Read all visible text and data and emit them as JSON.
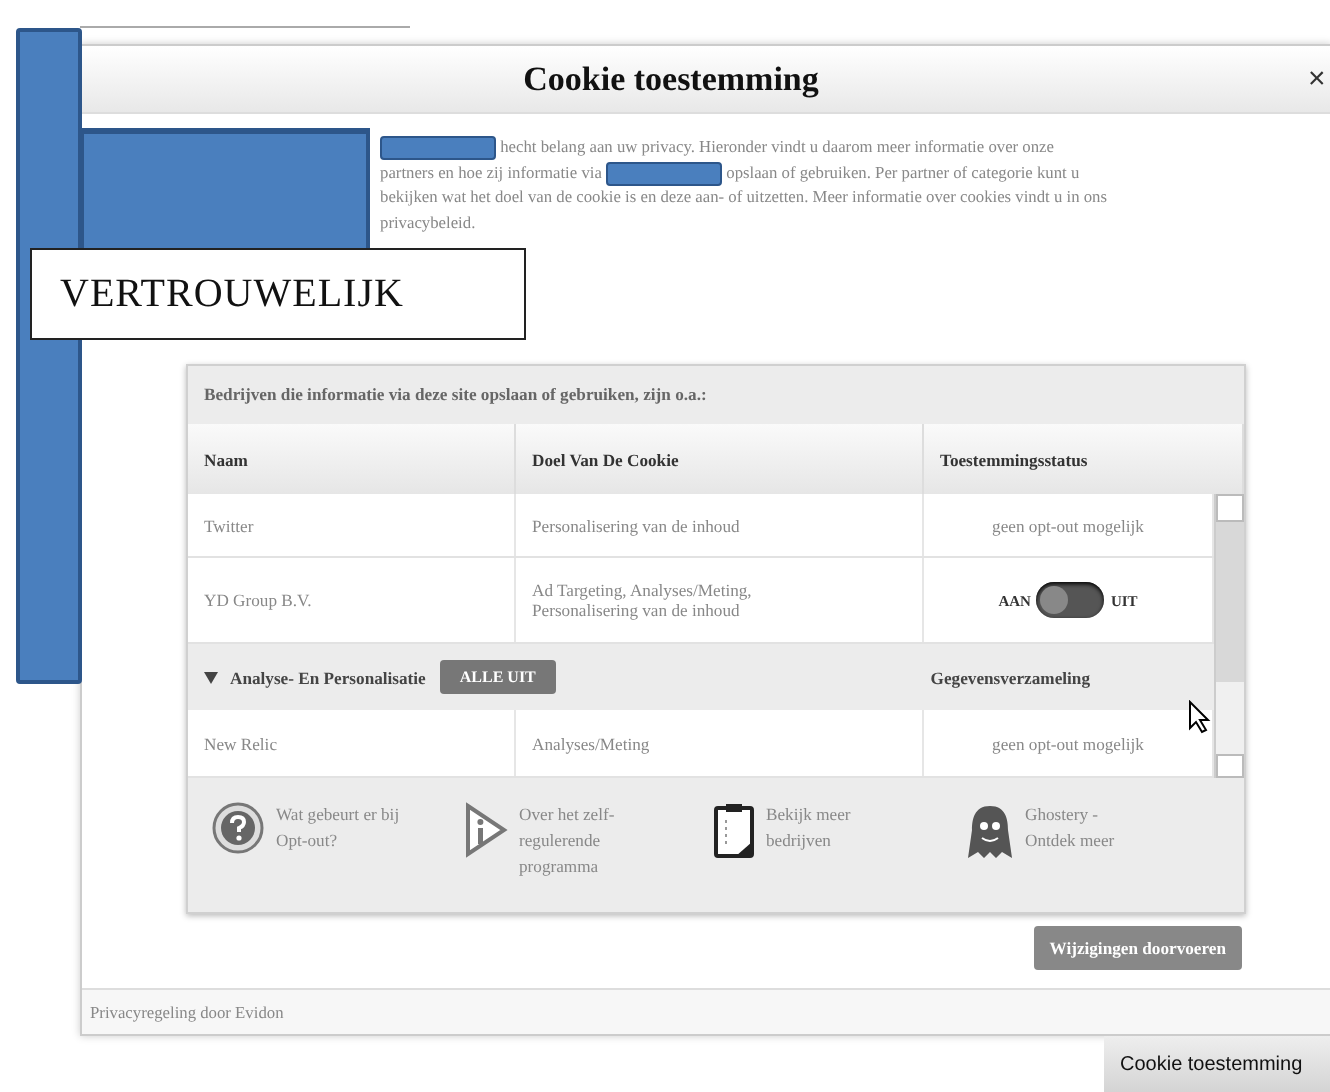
{
  "dialog": {
    "title": "Cookie toestemming",
    "close": "×",
    "intro": [
      "hecht belang aan uw privacy. Hieronder vindt u daarom meer informatie over onze partners en hoe zij informatie via",
      "opslaan of gebruiken. Per partner of categorie kunt u bekijken wat het doel van de cookie is en deze aan- of uitzetten. Meer informatie over cookies vindt u in ons privacybeleid."
    ],
    "panel_heading": "Bedrijven die informatie via deze site opslaan of gebruiken, zijn o.a.:",
    "columns": [
      "Naam",
      "Doel Van De Cookie",
      "Toestemmingsstatus"
    ],
    "rows": [
      {
        "kind": "partner",
        "name": "Twitter",
        "purpose": "Personalisering van de inhoud",
        "status": "geen opt-out mogelijk"
      },
      {
        "kind": "toggle",
        "name": "YD Group B.V.",
        "purpose": "Ad Targeting, Analyses/Meting, Personalisering van de inhoud",
        "on_label": "AAN",
        "off_label": "UIT",
        "on": false
      },
      {
        "kind": "group",
        "name": "Analyse- En Personalisatie",
        "expanded": true,
        "button": "ALLE UIT",
        "status": "Gegevensverzameling"
      },
      {
        "kind": "partner",
        "name": "New Relic",
        "purpose": "Analyses/Meting",
        "status": "geen opt-out mogelijk"
      }
    ],
    "links": [
      {
        "kind": "question",
        "text": "Wat gebeurt er bij Opt-out?"
      },
      {
        "kind": "info",
        "text": "Over het zelf-regulerende programma"
      },
      {
        "kind": "clipboard",
        "text": "Bekijk meer bedrijven"
      },
      {
        "kind": "ghost",
        "text": "Ghostery - Ontdek meer"
      }
    ],
    "apply_button": "Wijzigingen doorvoeren",
    "footer": "Privacyregeling door Evidon"
  },
  "stamp": "VERTROUWELIJK",
  "cookie_tab": "Cookie toestemming"
}
